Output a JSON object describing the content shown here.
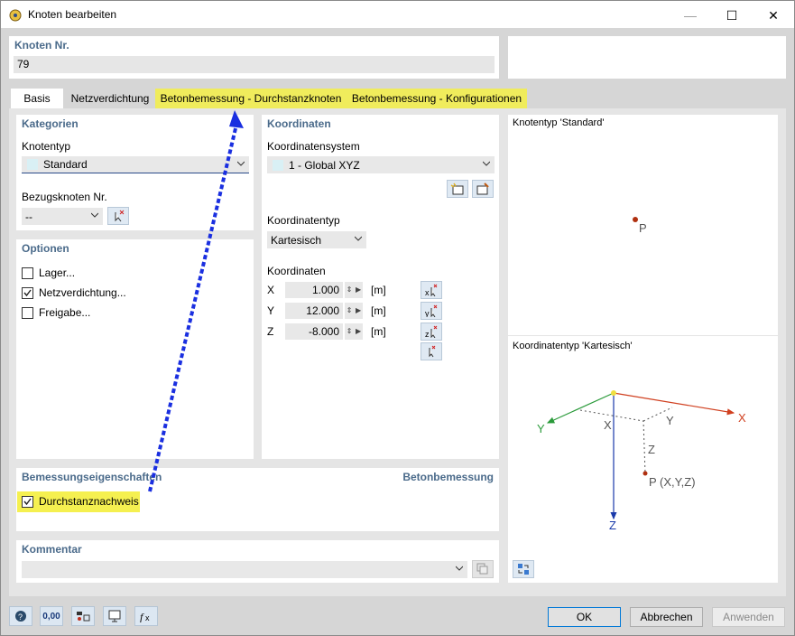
{
  "window": {
    "title": "Knoten bearbeiten",
    "minimize": "—",
    "maximize": "☐",
    "close": "✕"
  },
  "node": {
    "label": "Knoten Nr.",
    "value": "79"
  },
  "tabs": [
    {
      "label": "Basis"
    },
    {
      "label": "Netzverdichtung"
    },
    {
      "label": "Betonbemessung - Durchstanzknoten"
    },
    {
      "label": "Betonbemessung - Konfigurationen"
    }
  ],
  "kategorien": {
    "title": "Kategorien",
    "knotentyp_label": "Knotentyp",
    "knotentyp_value": "Standard",
    "bezug_label": "Bezugsknoten Nr.",
    "bezug_value": "--"
  },
  "optionen": {
    "title": "Optionen",
    "items": [
      {
        "label": "Lager...",
        "checked": false
      },
      {
        "label": "Netzverdichtung...",
        "checked": true
      },
      {
        "label": "Freigabe...",
        "checked": false
      }
    ]
  },
  "koordinaten": {
    "title": "Koordinaten",
    "system_label": "Koordinatensystem",
    "system_value": "1 - Global XYZ",
    "typ_label": "Koordinatentyp",
    "typ_value": "Kartesisch",
    "coords_label": "Koordinaten",
    "rows": [
      {
        "axis": "X",
        "value": "1.000",
        "unit": "[m]"
      },
      {
        "axis": "Y",
        "value": "12.000",
        "unit": "[m]"
      },
      {
        "axis": "Z",
        "value": "-8.000",
        "unit": "[m]"
      }
    ]
  },
  "bemessung": {
    "title": "Bemessungseigenschaften",
    "right": "Betonbemessung",
    "checkbox": "Durchstanznachweis",
    "checked": true
  },
  "kommentar": {
    "title": "Kommentar",
    "value": ""
  },
  "preview": {
    "top_title": "Knotentyp 'Standard'",
    "point_label": "P",
    "bottom_title": "Koordinatentyp 'Kartesisch'",
    "axis_x": "X",
    "axis_y": "Y",
    "axis_z": "Z",
    "inner_x": "X",
    "inner_y": "Y",
    "inner_z": "Z",
    "point_xyz": "P (X,Y,Z)"
  },
  "buttons": {
    "ok": "OK",
    "cancel": "Abbrechen",
    "apply": "Anwenden"
  },
  "bottom_icons": {
    "second": "0,00"
  },
  "colors": {
    "highlight": "#f5f050",
    "accent": "#4a6a8a",
    "arrow": "#1a2fe0"
  }
}
